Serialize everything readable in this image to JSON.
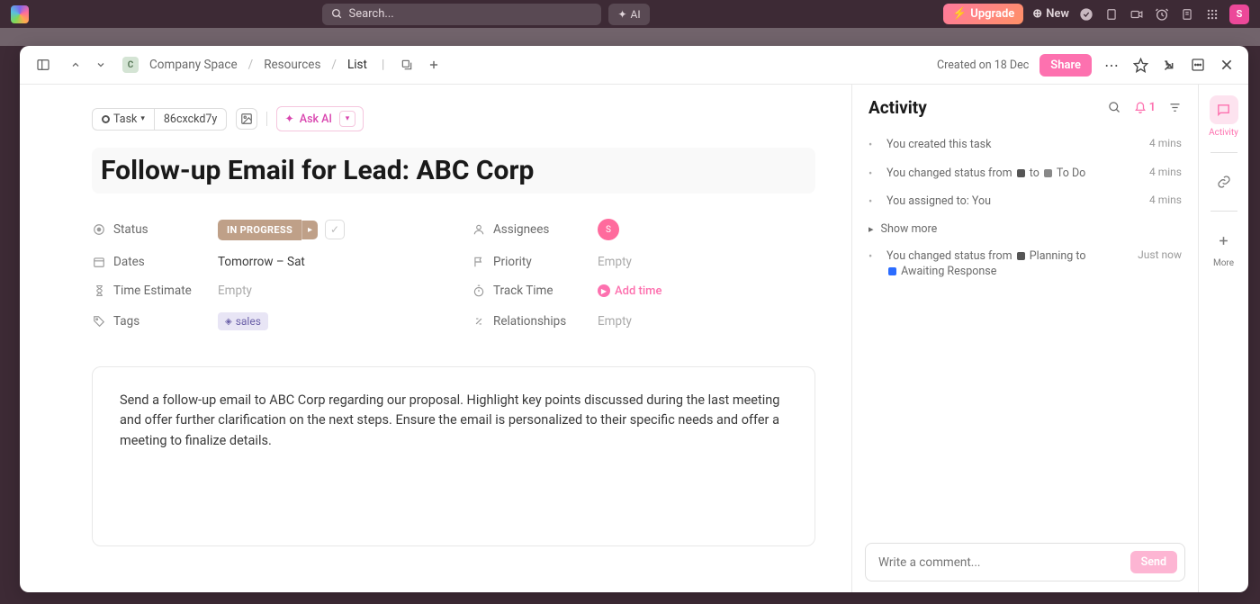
{
  "topbar": {
    "search_placeholder": "Search...",
    "ai_label": "AI",
    "upgrade_label": "Upgrade",
    "new_label": "New",
    "avatar_initial": "S"
  },
  "header": {
    "breadcrumb": {
      "space_badge": "C",
      "space": "Company Space",
      "folder": "Resources",
      "list": "List"
    },
    "created_on": "Created on 18 Dec",
    "share_label": "Share"
  },
  "task": {
    "type_label": "Task",
    "id": "86cxckd7y",
    "ask_ai_label": "Ask AI",
    "title": "Follow-up Email for Lead: ABC Corp",
    "fields": {
      "status": {
        "label": "Status",
        "value": "IN PROGRESS"
      },
      "assignees": {
        "label": "Assignees",
        "avatar_initial": "S"
      },
      "dates": {
        "label": "Dates",
        "value": "Tomorrow – Sat"
      },
      "priority": {
        "label": "Priority",
        "value": "Empty"
      },
      "time_estimate": {
        "label": "Time Estimate",
        "value": "Empty"
      },
      "track_time": {
        "label": "Track Time",
        "value": "Add time"
      },
      "tags": {
        "label": "Tags",
        "value": "sales"
      },
      "relationships": {
        "label": "Relationships",
        "value": "Empty"
      }
    },
    "description": "Send a follow-up email to ABC Corp regarding our proposal. Highlight key points discussed during the last meeting and offer further clarification on the next steps. Ensure the email is personalized to their specific needs and offer a meeting to finalize details."
  },
  "activity": {
    "title": "Activity",
    "notif_count": "1",
    "show_more_label": "Show more",
    "items": [
      {
        "text": "You created this task",
        "time": "4 mins"
      },
      {
        "text_parts": [
          "You changed status from ",
          " to ",
          " To Do"
        ],
        "sq_colors": [
          "#555",
          "#888"
        ],
        "time": "4 mins"
      },
      {
        "text": "You assigned to: You",
        "time": "4 mins"
      }
    ],
    "extra": {
      "text_parts": [
        "You changed status from ",
        " Planning to ",
        " Awaiting Response"
      ],
      "sq_colors": [
        "#555",
        "#2b6cff"
      ],
      "time": "Just now"
    },
    "comment_placeholder": "Write a comment...",
    "send_label": "Send"
  },
  "rail": {
    "activity_label": "Activity",
    "more_label": "More"
  }
}
